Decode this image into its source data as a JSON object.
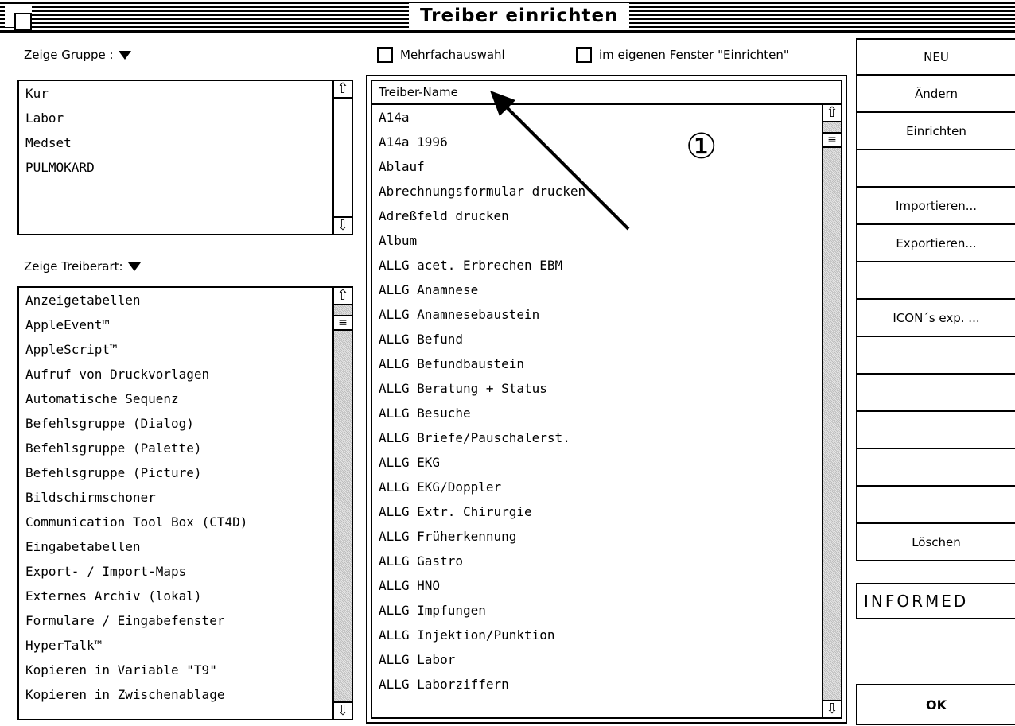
{
  "window": {
    "title": "Treiber einrichten"
  },
  "group": {
    "label": "Zeige Gruppe :",
    "items": [
      "Kur",
      "Labor",
      "Medset",
      "PULMOKARD"
    ]
  },
  "treiberart": {
    "label": "Zeige Treiberart:",
    "items": [
      "Anzeigetabellen",
      "AppleEvent™",
      "AppleScript™",
      "Aufruf von Druckvorlagen",
      "Automatische Sequenz",
      "Befehlsgruppe (Dialog)",
      "Befehlsgruppe (Palette)",
      "Befehlsgruppe (Picture)",
      "Bildschirmschoner",
      "Communication Tool Box (CT4D)",
      "Eingabetabellen",
      "Export- / Import-Maps",
      "Externes Archiv (lokal)",
      "Formulare / Eingabefenster",
      "HyperTalk™",
      "Kopieren in Variable \"T9\"",
      "Kopieren in Zwischenablage"
    ]
  },
  "options": {
    "mehrfach_label": "Mehrfachauswahl",
    "eigenes_label": "im eigenen Fenster \"Einrichten\""
  },
  "treiber": {
    "header": "Treiber-Name",
    "items": [
      "A14a",
      "A14a_1996",
      "Ablauf",
      "Abrechnungsformular drucken",
      "Adreßfeld drucken",
      "Album",
      "ALLG acet. Erbrechen EBM",
      "ALLG Anamnese",
      "ALLG Anamnesebaustein",
      "ALLG Befund",
      "ALLG Befundbaustein",
      "ALLG Beratung + Status",
      "ALLG Besuche",
      "ALLG Briefe/Pauschalerst.",
      "ALLG EKG",
      "ALLG EKG/Doppler",
      "ALLG Extr. Chirurgie",
      "ALLG Früherkennung",
      "ALLG Gastro",
      "ALLG HNO",
      "ALLG Impfungen",
      "ALLG Injektion/Punktion",
      "ALLG Labor",
      "ALLG Laborziffern"
    ]
  },
  "annotation": {
    "marker": "①"
  },
  "buttons": {
    "neu": "NEU",
    "aendern": "Ändern",
    "einrichten": "Einrichten",
    "importieren": "Importieren...",
    "exportieren": "Exportieren...",
    "icons_exp": "ICON´s exp. ...",
    "loeschen": "Löschen",
    "ok": "OK"
  },
  "logo": "INFORMED",
  "icons": {
    "scroll_up": "up-arrow-icon",
    "scroll_down": "down-arrow-icon",
    "popup": "triangle-down-icon",
    "scroll_thumb": "scroll-thumb-icon"
  }
}
